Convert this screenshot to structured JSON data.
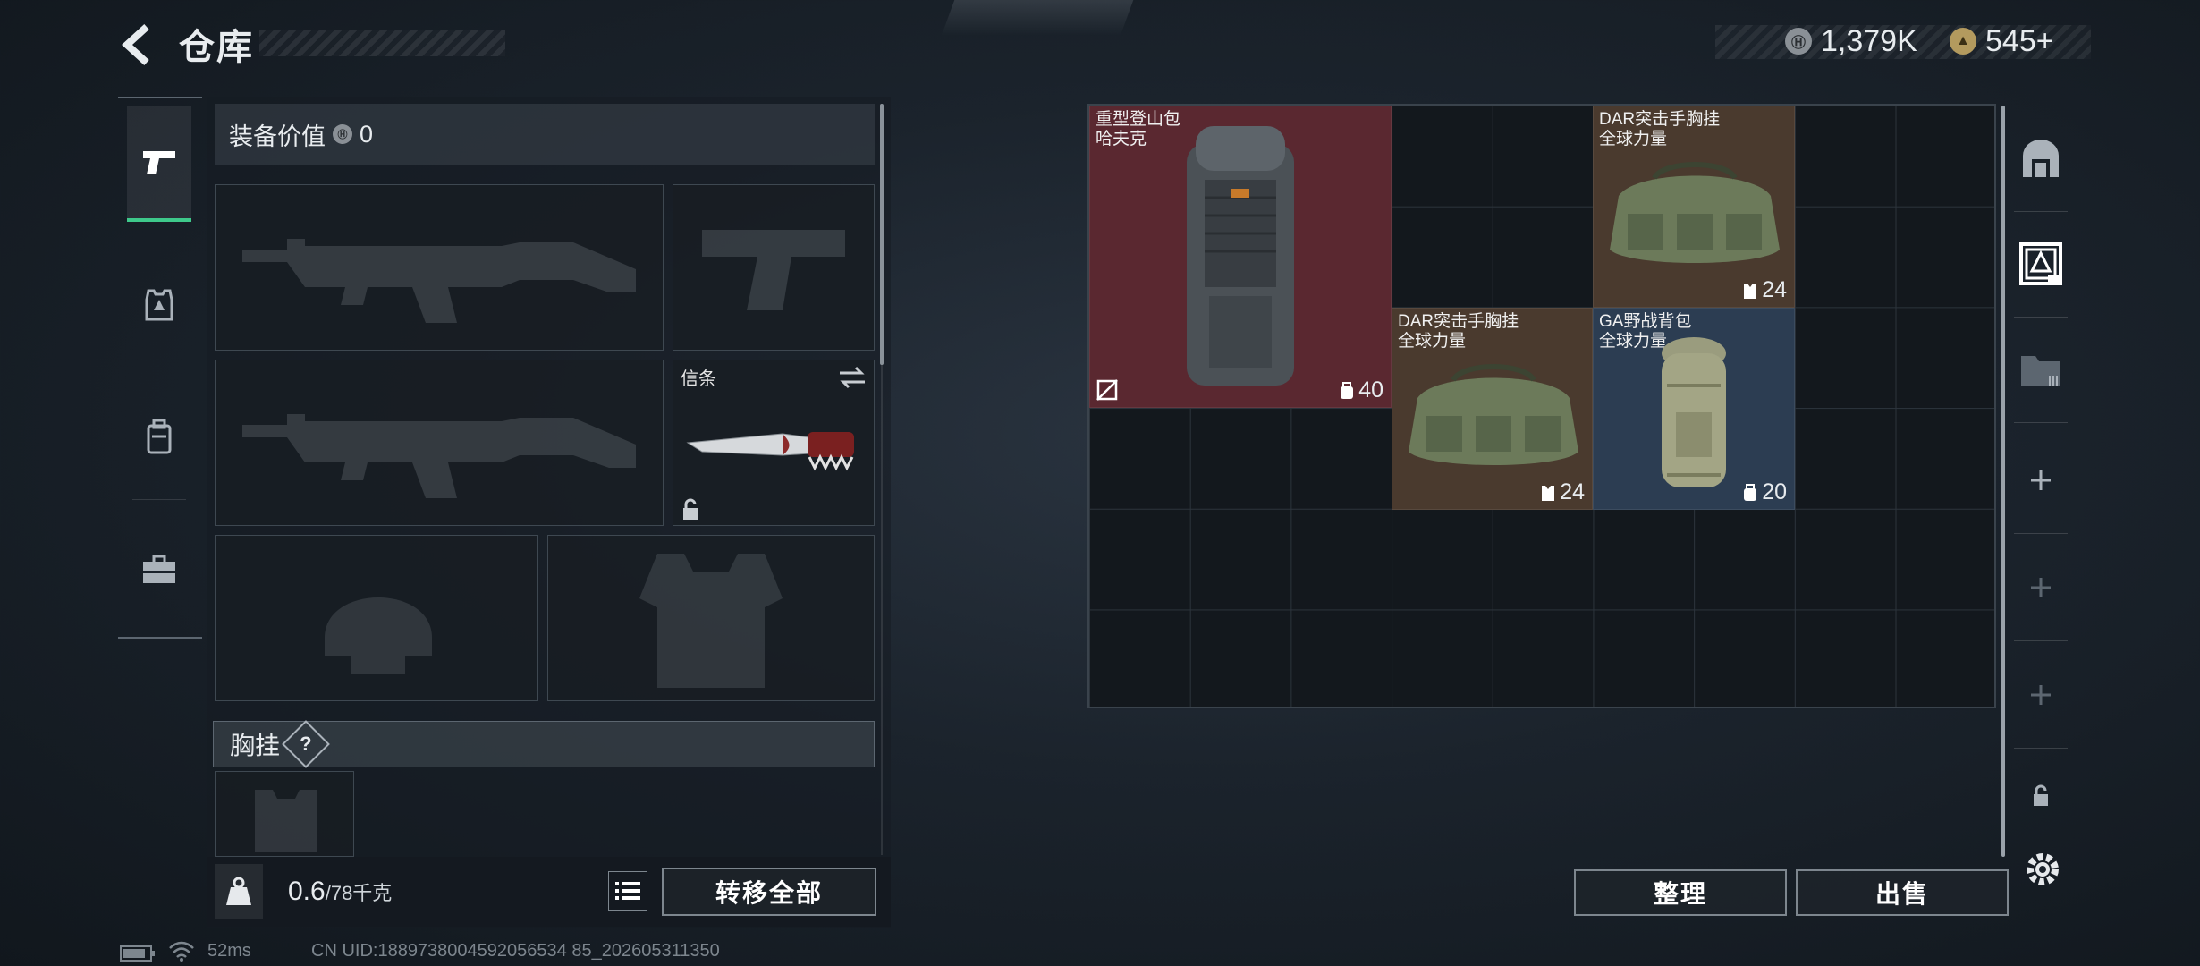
{
  "header": {
    "title": "仓库",
    "currency_silver": "1,379K",
    "currency_gold": "545+"
  },
  "tabs": [
    {
      "name": "weapons",
      "icon": "pistol-icon",
      "active": true
    },
    {
      "name": "armor",
      "icon": "armor-icon",
      "active": false
    },
    {
      "name": "backpack",
      "icon": "backpack-icon",
      "active": false
    },
    {
      "name": "supplies",
      "icon": "toolbox-icon",
      "active": false
    }
  ],
  "equipment": {
    "value_label": "装备价值",
    "value": "0",
    "secure_slot_label": "信条",
    "vest_label": "胸挂",
    "vest_help": "?"
  },
  "bottom": {
    "weight_current": "0.6",
    "weight_max": "/78千克",
    "transfer_all": "转移全部"
  },
  "storage": {
    "items": [
      {
        "name": "重型登山包",
        "sub": "哈夫克",
        "capacity": "40",
        "color": "#5a2830"
      },
      {
        "name": "DAR突击手胸挂",
        "sub": "全球力量",
        "capacity": "24",
        "color": "#4a3a2e"
      },
      {
        "name": "DAR突击手胸挂",
        "sub": "全球力量",
        "capacity": "24",
        "color": "#4a3a2e"
      },
      {
        "name": "GA野战背包",
        "sub": "全球力量",
        "capacity": "20",
        "color": "#2c3d52"
      }
    ],
    "sort_label": "整理",
    "sell_label": "出售"
  },
  "status": {
    "ping": "52ms",
    "uid": "CN UID:1889738004592056534 85_202605311350"
  },
  "colors": {
    "accent_green": "#3ec98b",
    "rare_red": "#5a2830",
    "rare_blue": "#2c3d52",
    "rare_brown": "#4a3a2e"
  }
}
